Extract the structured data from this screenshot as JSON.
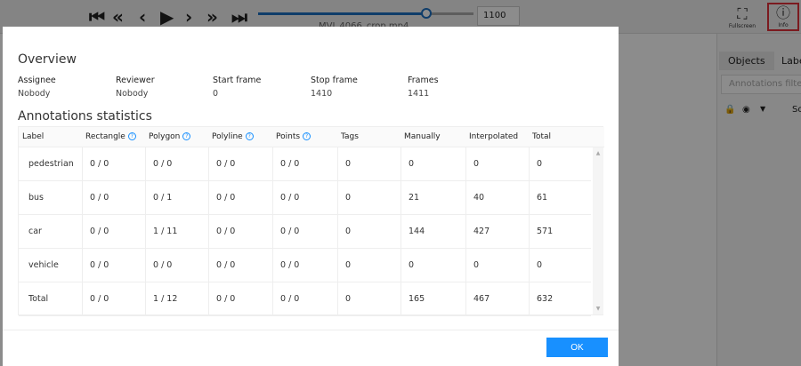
{
  "player": {
    "buttons": [
      "first",
      "fast-backward",
      "previous",
      "play",
      "next",
      "fast-forward",
      "last"
    ],
    "progress": 0.78,
    "frame": "1100",
    "filename": "MVI_4066_crop.mp4"
  },
  "tools": {
    "fullscreen": "Fullscreen",
    "info": "Info"
  },
  "sidebar": {
    "tabs": [
      "Objects",
      "Labels"
    ],
    "filter_placeholder": "Annotations filter",
    "sort": "So"
  },
  "modal": {
    "overview_title": "Overview",
    "fields": [
      {
        "label": "Assignee",
        "value": "Nobody"
      },
      {
        "label": "Reviewer",
        "value": "Nobody"
      },
      {
        "label": "Start frame",
        "value": "0"
      },
      {
        "label": "Stop frame",
        "value": "1410"
      },
      {
        "label": "Frames",
        "value": "1411"
      }
    ],
    "stats_title": "Annotations statistics",
    "columns": [
      "Label",
      "Rectangle",
      "Polygon",
      "Polyline",
      "Points",
      "Tags",
      "Manually",
      "Interpolated",
      "Total"
    ],
    "rows": [
      [
        "pedestrian",
        "0 / 0",
        "0 / 0",
        "0 / 0",
        "0 / 0",
        "0",
        "0",
        "0",
        "0"
      ],
      [
        "bus",
        "0 / 0",
        "0 / 1",
        "0 / 0",
        "0 / 0",
        "0",
        "21",
        "40",
        "61"
      ],
      [
        "car",
        "0 / 0",
        "1 / 11",
        "0 / 0",
        "0 / 0",
        "0",
        "144",
        "427",
        "571"
      ],
      [
        "vehicle",
        "0 / 0",
        "0 / 0",
        "0 / 0",
        "0 / 0",
        "0",
        "0",
        "0",
        "0"
      ],
      [
        "Total",
        "0 / 0",
        "1 / 12",
        "0 / 0",
        "0 / 0",
        "0",
        "165",
        "467",
        "632"
      ]
    ],
    "ok": "OK"
  }
}
